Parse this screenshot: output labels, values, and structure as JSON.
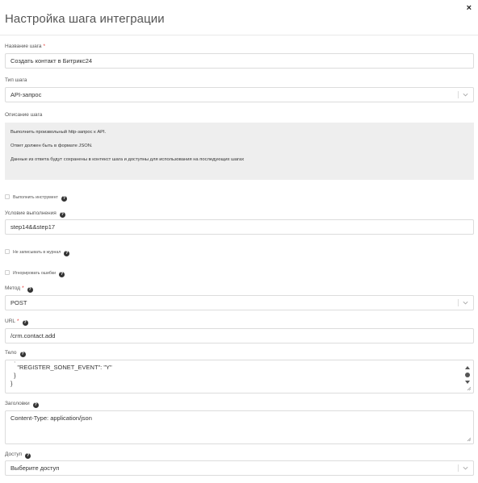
{
  "dialog": {
    "title": "Настройка шага интеграции",
    "close_glyph": "×"
  },
  "fields": {
    "step_name": {
      "label": "Название шага",
      "required_mark": "*",
      "value": "Создать контакт в Битрикс24"
    },
    "step_type": {
      "label": "Тип шага",
      "value": "API-запрос"
    },
    "description": {
      "label": "Описание шага",
      "lines": [
        "Выполнить произвольный http-запрос к API.",
        "Ответ должен быть в формате JSON.",
        "Данные из ответа будут сохранены в контекст шага и доступны для использования на последующих шагах"
      ]
    },
    "run_tool": {
      "label": "Выполнить инструмент"
    },
    "condition": {
      "label": "Условие выполнения",
      "value": "step14&&step17"
    },
    "no_log": {
      "label": "Не записывать в журнал"
    },
    "ignore_errors": {
      "label": "Игнорировать ошибки"
    },
    "method": {
      "label": "Метод",
      "required_mark": "*",
      "value": "POST"
    },
    "url": {
      "label": "URL",
      "required_mark": "*",
      "value": "/crm.contact.add"
    },
    "body": {
      "label": "Тело",
      "lines": [
        "    \"REGISTER_SONET_EVENT\": \"Y\"",
        "  }",
        "}"
      ]
    },
    "headers": {
      "label": "Заголовки",
      "value": "Content-Type: application/json"
    },
    "access": {
      "label": "Доступ",
      "placeholder": "Выберите доступ"
    }
  },
  "icons": {
    "help": "question-circle-icon",
    "chevron": "chevron-down-icon",
    "help_glyph": "?"
  },
  "colors": {
    "required": "#e53935",
    "description_bg": "#eeeeee",
    "border": "#dcdcdc"
  }
}
